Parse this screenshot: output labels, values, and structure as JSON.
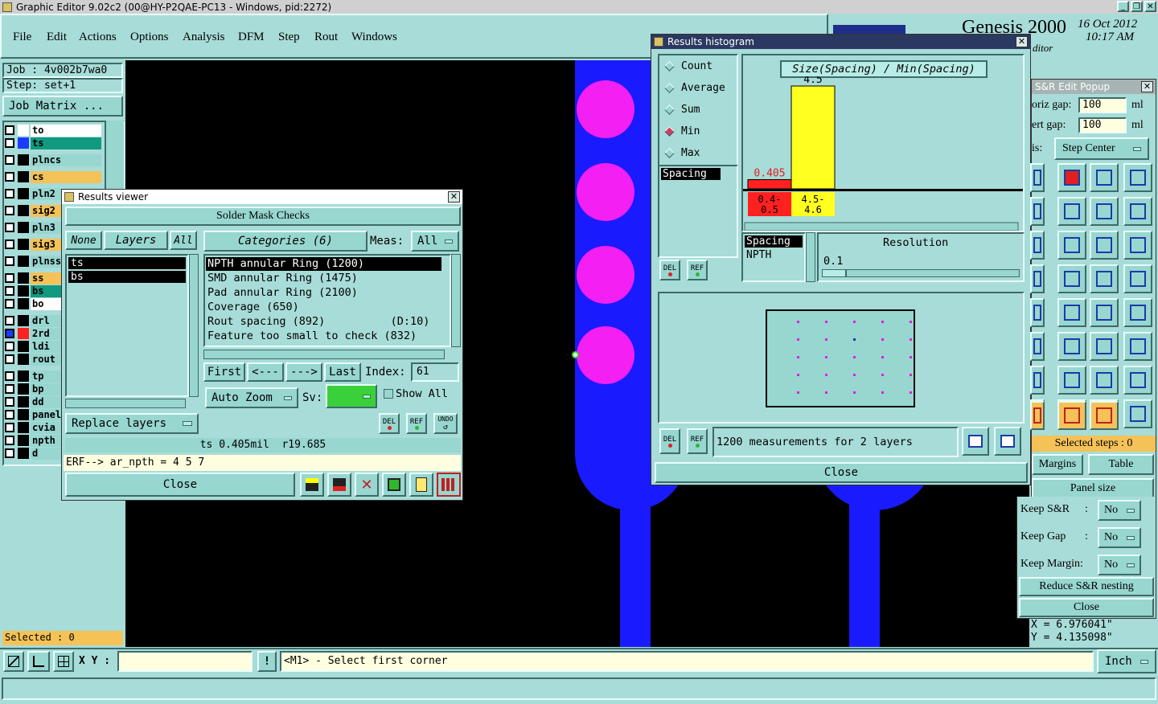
{
  "window": {
    "title": "Graphic Editor 9.02c2 (00@HY-P2QAE-PC13 - Windows, pid:2272)"
  },
  "menu": [
    "File",
    "Edit",
    "Actions",
    "Options",
    "Analysis",
    "DFM",
    "Step",
    "Rout",
    "Windows"
  ],
  "brand": {
    "name": "Genesis 2000",
    "date": "16 Oct 2012",
    "time": "10:17 AM",
    "sub": "ditor"
  },
  "job": {
    "job_label": "Job : 4v002b7wa0",
    "step_label": "Step: set+1",
    "matrix_button": "Job Matrix ..."
  },
  "layers": [
    {
      "name": "to",
      "color": "#ffffff",
      "swatch": "#ffffff"
    },
    {
      "name": "ts",
      "color": "#119a80",
      "swatch": "#1a3cff"
    },
    {
      "name": "plncs",
      "color": "#98d6d0",
      "swatch": ""
    },
    {
      "name": "cs",
      "color": "#f4c257",
      "swatch": ""
    },
    {
      "name": "pln2",
      "color": "#98d6d0",
      "swatch": ""
    },
    {
      "name": "sig2",
      "color": "#f4c257",
      "swatch": ""
    },
    {
      "name": "pln3",
      "color": "#98d6d0",
      "swatch": ""
    },
    {
      "name": "sig3",
      "color": "#f4c257",
      "swatch": ""
    },
    {
      "name": "plnss",
      "color": "#98d6d0",
      "swatch": ""
    },
    {
      "name": "ss",
      "color": "#f4c257",
      "swatch": ""
    },
    {
      "name": "bs",
      "color": "#119a80",
      "swatch": ""
    },
    {
      "name": "bo",
      "color": "#ffffff",
      "swatch": ""
    },
    {
      "name": "drl",
      "color": "#98d6d0",
      "swatch": ""
    },
    {
      "name": "2rd",
      "color": "#98d6d0",
      "swatch": "#ff2020"
    },
    {
      "name": "ldi",
      "color": "#98d6d0",
      "swatch": ""
    },
    {
      "name": "rout",
      "color": "#98d6d0",
      "swatch": ""
    },
    {
      "name": "tp",
      "color": "#98d6d0",
      "swatch": ""
    },
    {
      "name": "bp",
      "color": "#98d6d0",
      "swatch": ""
    },
    {
      "name": "dd",
      "color": "#98d6d0",
      "swatch": ""
    },
    {
      "name": "panel",
      "color": "#98d6d0",
      "swatch": ""
    },
    {
      "name": "cvia",
      "color": "#98d6d0",
      "swatch": ""
    },
    {
      "name": "npth",
      "color": "#98d6d0",
      "swatch": ""
    },
    {
      "name": "d",
      "color": "#98d6d0",
      "swatch": ""
    }
  ],
  "selected_label": "Selected : 0",
  "results_viewer": {
    "title": "Results viewer",
    "header": "Solder Mask Checks",
    "none_btn": "None",
    "layers_btn": "Layers",
    "all_btn": "All",
    "categories_btn": "Categories (6)",
    "meas_label": "Meas:",
    "meas_value": "All",
    "layer_items": [
      "ts",
      "bs"
    ],
    "categories": [
      "NPTH annular Ring (1200)",
      "SMD annular Ring (1475)",
      "Pad annular Ring (2100)",
      "Coverage (650)",
      "Rout spacing (892)          (D:10)",
      "Feature too small to check (832)"
    ],
    "first_btn": "First",
    "prev_btn": "<---",
    "next_btn": "--->",
    "last_btn": "Last",
    "index_label": "Index:",
    "index_value": "61",
    "zoom_btn": "Auto Zoom",
    "sv_label": "Sv:",
    "show_all": "Show All",
    "replace_btn": "Replace layers",
    "del": "DEL",
    "ref": "REF",
    "undo": "UNDO",
    "status": "ts 0.405mil  r19.685",
    "erf": "ERF--> ar_npth = 4 5 7",
    "close": "Close"
  },
  "histogram": {
    "title": "Results histogram",
    "modes": [
      "Count",
      "Average",
      "Sum",
      "Min",
      "Max"
    ],
    "selected_mode": "Min",
    "chart_title": "Size(Spacing) / Min(Spacing)",
    "spacing_item": "Spacing",
    "resolution_label": "Resolution",
    "resolution_value": "0.1",
    "list_items": [
      "Spacing",
      "NPTH"
    ],
    "measurements": "1200 measurements for 2 layers",
    "close": "Close",
    "del": "DEL",
    "ref": "REF"
  },
  "chart_data": {
    "type": "bar",
    "title": "Size(Spacing) / Min(Spacing)",
    "categories": [
      "0.4-0.5",
      "4.5-4.6"
    ],
    "values": [
      0.405,
      4.5
    ],
    "colors": [
      "#ff2020",
      "#ffff20"
    ],
    "value_labels": [
      "0.405",
      "4.5"
    ],
    "category_labels": [
      [
        "0.4-",
        "0.5"
      ],
      [
        "4.5-",
        "4.6"
      ]
    ],
    "ylim": [
      0,
      4.5
    ]
  },
  "sr_popup": {
    "title": "S&R Edit Popup",
    "horiz_gap_label": "oriz gap:",
    "horiz_gap_value": "100",
    "vert_gap_label": "ert gap:",
    "vert_gap_value": "100",
    "unit": "ml",
    "axis_label": "is:",
    "axis_value": "Step Center",
    "selected_steps": "Selected steps : 0",
    "margins": "Margins",
    "table": "Table",
    "panel_size": "Panel size",
    "keep_sr": "Keep S&R",
    "keep_gap": "Keep Gap",
    "keep_margin": "Keep Margin:",
    "colon": ":",
    "no": "No",
    "reduce": "Reduce S&R nesting",
    "close": "Close"
  },
  "coords": {
    "x": "X = 6.976041\"",
    "y": "Y = 4.135098\""
  },
  "bottom": {
    "xy_label": "X Y :",
    "message": "<M1> - Select first corner",
    "unit": "Inch",
    "excl": "!"
  }
}
